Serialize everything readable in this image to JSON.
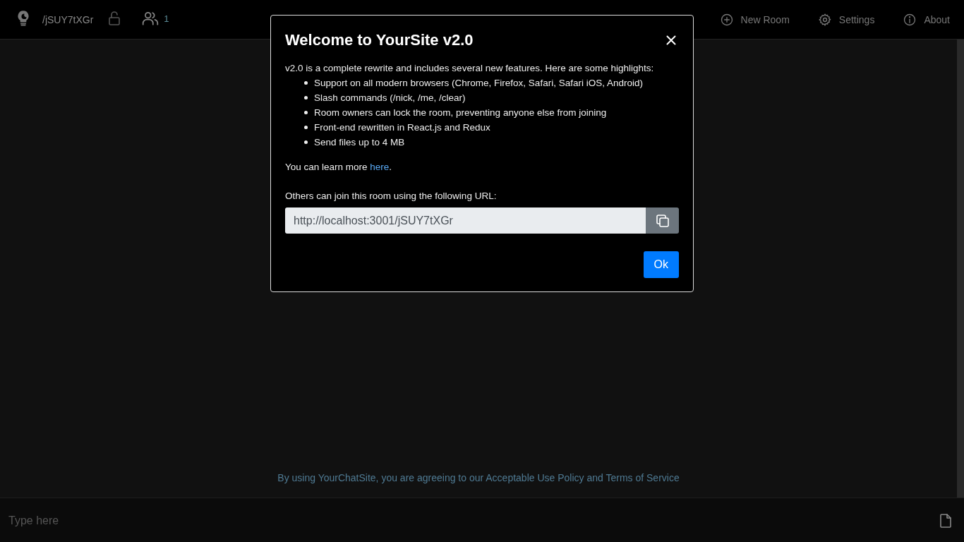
{
  "navbar": {
    "room_path": "/jSUY7tXGr",
    "locked": false,
    "user_count": "1",
    "items": [
      {
        "label": "New Room",
        "kind": "plus"
      },
      {
        "label": "Settings",
        "kind": "gear"
      },
      {
        "label": "About",
        "kind": "info"
      }
    ]
  },
  "modal": {
    "title": "Welcome to YourSite v2.0",
    "intro": "v2.0 is a complete rewrite and includes several new features. Here are some highlights:",
    "highlights": [
      "Support on all modern browsers (Chrome, Firefox, Safari, Safari iOS, Android)",
      "Slash commands (/nick, /me, /clear)",
      "Room owners can lock the room, preventing anyone else from joining",
      "Front-end rewritten in React.js and Redux",
      "Send files up to 4 MB"
    ],
    "learn_more": {
      "before": "You can learn more ",
      "link": "here",
      "after": "."
    },
    "url_label": "Others can join this room using the following URL:",
    "url_value": "http://localhost:3001/jSUY7tXGr",
    "ok_button": "Ok"
  },
  "footer_notice": "By using YourChatSite, you are agreeing to our Acceptable Use Policy and Terms of Service",
  "composer": {
    "placeholder": "Type here"
  }
}
